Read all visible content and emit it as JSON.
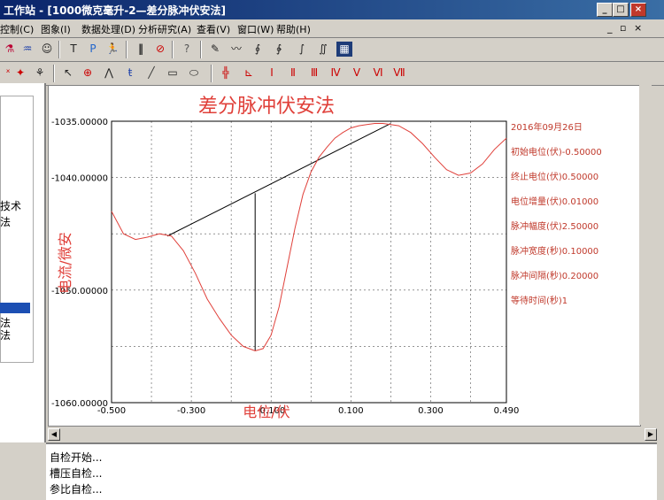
{
  "window": {
    "title": "工作站 - [1000微克毫升-2—差分脉冲伏安法]",
    "min": "_",
    "max": "□",
    "close": "×",
    "mdi_min": "_",
    "mdi_restore": "▫",
    "mdi_close": "×"
  },
  "menu": [
    {
      "label": "控制(C)"
    },
    {
      "label": "图象(I)"
    },
    {
      "label": "数据处理(D)"
    },
    {
      "label": "分析研究(A)"
    },
    {
      "label": "查看(V)"
    },
    {
      "label": "窗口(W)"
    },
    {
      "label": "帮助(H)"
    }
  ],
  "left_panel": {
    "text1": "技术",
    "text2": "法",
    "text3": "法",
    "text4": "法"
  },
  "chart_data": {
    "type": "line",
    "title": "差分脉冲伏安法",
    "xlabel": "电位/伏",
    "ylabel": "电流/微安",
    "xlim": [
      -0.5,
      0.49
    ],
    "ylim": [
      -1060.0,
      -1035.0
    ],
    "x_ticks": [
      -0.5,
      -0.3,
      -0.1,
      0.1,
      0.3,
      0.49
    ],
    "x_tick_labels": [
      "-0.500",
      "-0.300",
      "-0.100",
      "0.100",
      "0.300",
      "0.490"
    ],
    "y_ticks": [
      -1035.0,
      -1040.0,
      -1050.0,
      -1060.0
    ],
    "y_tick_labels": [
      "-1035.00000",
      "-1040.00000",
      "-1050.00000",
      "-1060.00000"
    ],
    "grid": true,
    "series": [
      {
        "color": "#e0403a",
        "x": [
          -0.5,
          -0.47,
          -0.44,
          -0.41,
          -0.38,
          -0.35,
          -0.32,
          -0.29,
          -0.26,
          -0.23,
          -0.2,
          -0.17,
          -0.14,
          -0.12,
          -0.1,
          -0.08,
          -0.06,
          -0.04,
          -0.02,
          0.0,
          0.02,
          0.04,
          0.06,
          0.08,
          0.1,
          0.12,
          0.14,
          0.16,
          0.18,
          0.2,
          0.22,
          0.25,
          0.28,
          0.31,
          0.34,
          0.37,
          0.4,
          0.43,
          0.46,
          0.49
        ],
        "y": [
          -1043.0,
          -1045.0,
          -1045.5,
          -1045.3,
          -1045.0,
          -1045.2,
          -1046.5,
          -1048.5,
          -1050.8,
          -1052.5,
          -1054.0,
          -1055.0,
          -1055.4,
          -1055.2,
          -1054.0,
          -1051.5,
          -1048.0,
          -1044.5,
          -1041.5,
          -1039.5,
          -1038.2,
          -1037.3,
          -1036.5,
          -1036.0,
          -1035.6,
          -1035.4,
          -1035.3,
          -1035.2,
          -1035.2,
          -1035.3,
          -1035.4,
          -1036.0,
          -1037.0,
          -1038.2,
          -1039.3,
          -1039.8,
          -1039.6,
          -1038.8,
          -1037.5,
          -1036.5
        ]
      }
    ],
    "baseline": {
      "x": [
        -0.36,
        0.2
      ],
      "y": [
        -1045.2,
        -1035.2
      ]
    },
    "peak_line": {
      "x": [
        -0.14,
        -0.14
      ],
      "y": [
        -1041.4,
        -1055.4
      ]
    },
    "params": [
      "2016年09月26日",
      "初始电位(伏)-0.50000",
      "终止电位(伏)0.50000",
      "电位增量(伏)0.01000",
      "脉冲幅度(伏)2.50000",
      "脉冲宽度(秒)0.10000",
      "脉冲间隔(秒)0.20000",
      "等待时间(秒)1"
    ]
  },
  "status": {
    "line1": "自检开始...",
    "line2": "槽压自检...",
    "line3": "参比自检..."
  }
}
